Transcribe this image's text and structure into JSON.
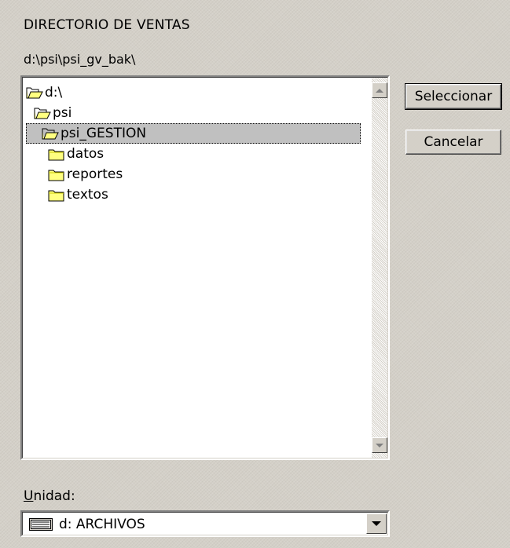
{
  "dialog": {
    "title": "DIRECTORIO DE VENTAS",
    "current_path": "d:\\psi\\psi_gv_bak\\"
  },
  "tree": {
    "items": [
      {
        "label": "d:\\",
        "icon": "open-folder-icon",
        "selected": false
      },
      {
        "label": "psi",
        "icon": "open-folder-icon",
        "selected": false
      },
      {
        "label": "psi_GESTION",
        "icon": "open-folder-icon",
        "selected": true
      },
      {
        "label": "datos",
        "icon": "folder-icon",
        "selected": false
      },
      {
        "label": "reportes",
        "icon": "folder-icon",
        "selected": false
      },
      {
        "label": "textos",
        "icon": "folder-icon",
        "selected": false
      }
    ]
  },
  "buttons": {
    "select": "Seleccionar",
    "cancel": "Cancelar"
  },
  "drive": {
    "label_u": "U",
    "label_rest": "nidad:",
    "value": "d: ARCHIVOS",
    "icon": "drive-icon"
  },
  "colors": {
    "face": "#d4d0c8",
    "selection": "#c0c0c0",
    "folder": "#ffff80"
  }
}
